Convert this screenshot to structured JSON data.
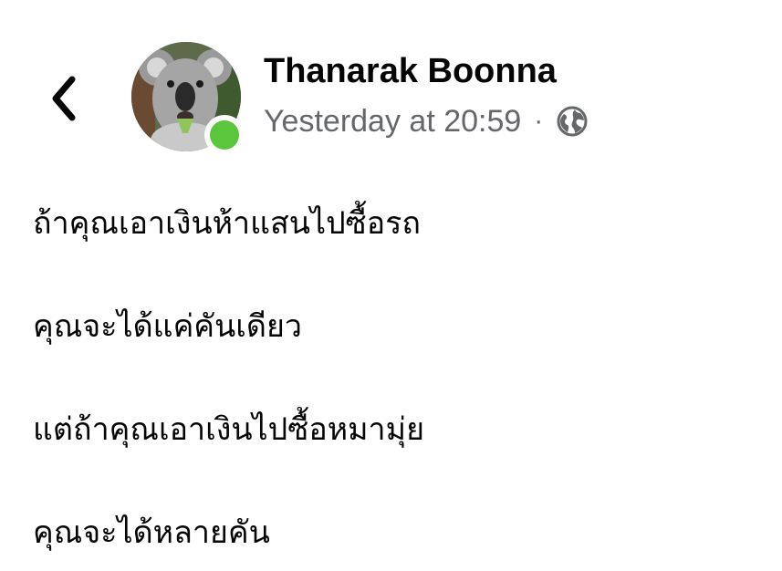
{
  "header": {
    "back_icon": "chevron-left-icon",
    "author_name": "Thanarak Boonna",
    "timestamp": "Yesterday at 20:59",
    "separator": "·",
    "privacy_icon": "globe-icon",
    "status_color": "#5ac63b"
  },
  "post": {
    "lines": [
      "ถ้าคุณเอาเงินห้าแสนไปซื้อรถ",
      "คุณจะได้แค่คันเดียว",
      "แต่ถ้าคุณเอาเงินไปซื้อหมามุ่ย",
      "คุณจะได้หลายคัน"
    ]
  }
}
